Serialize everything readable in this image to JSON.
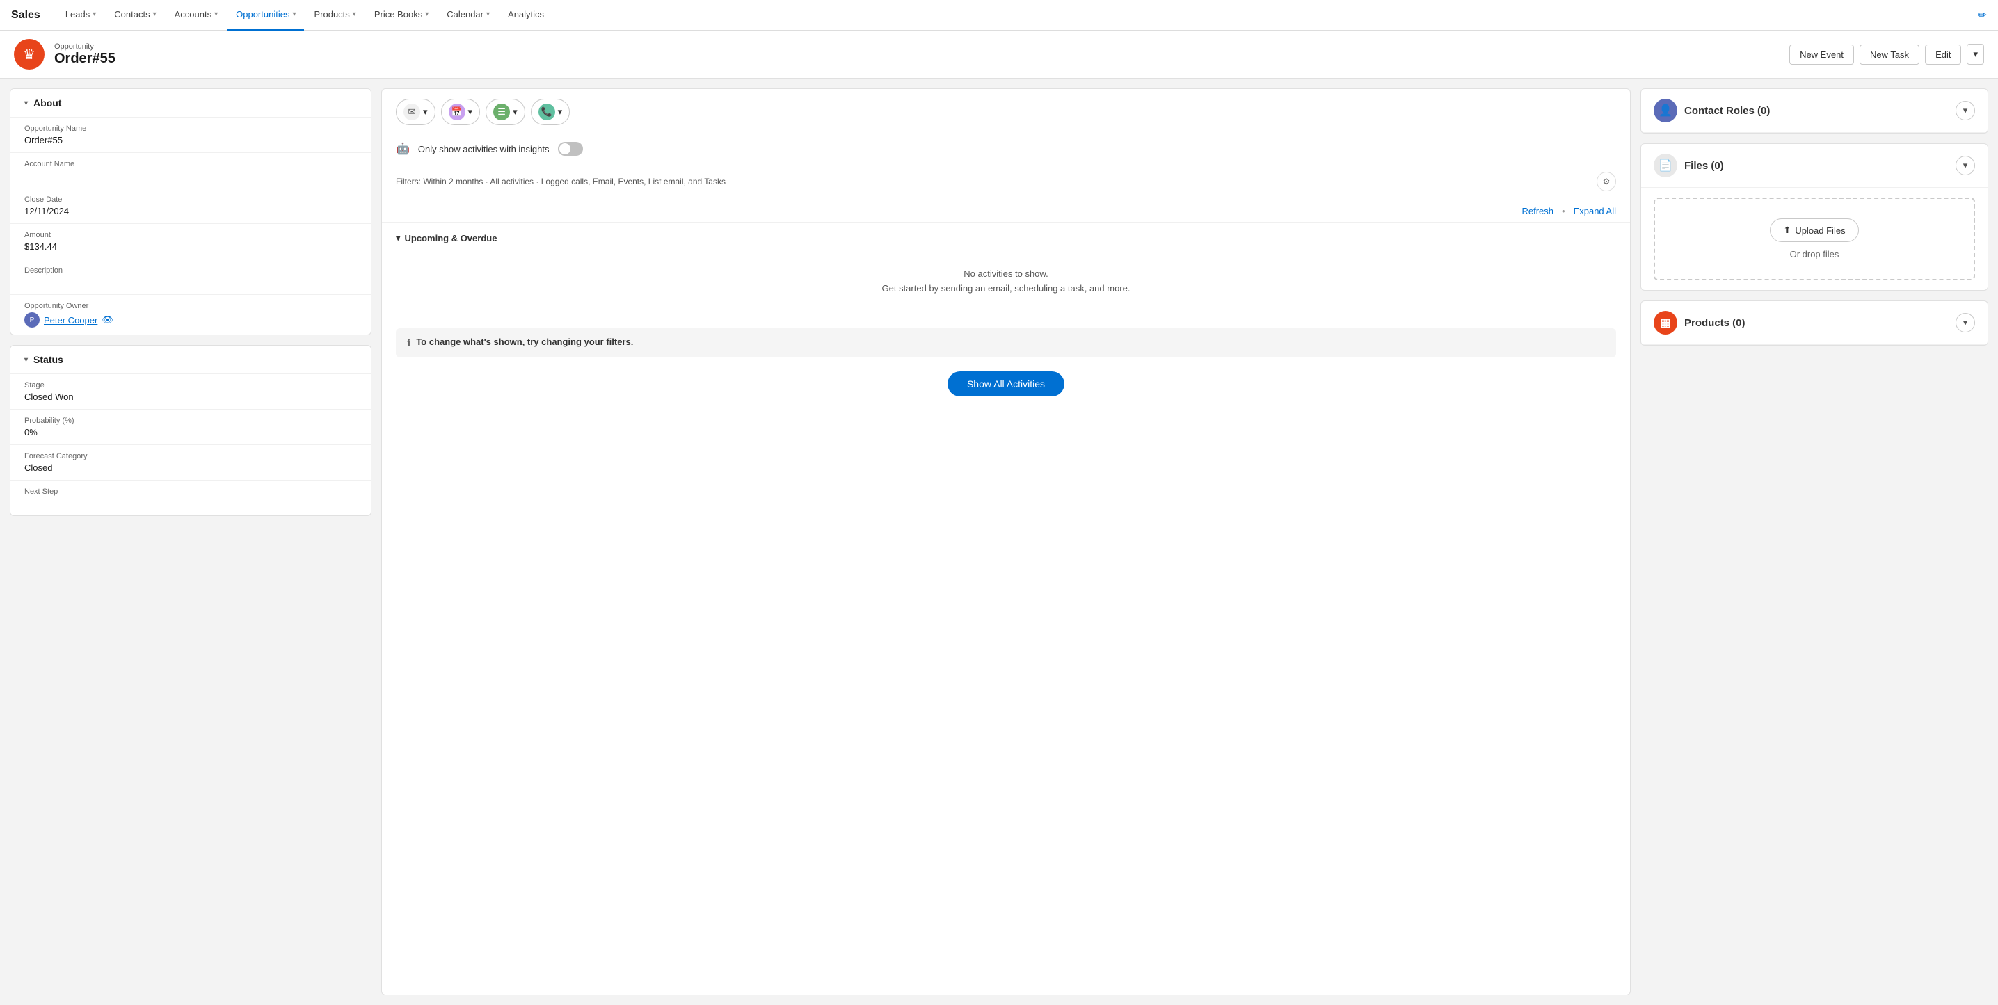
{
  "brand": "Sales",
  "nav": {
    "items": [
      {
        "label": "Leads",
        "hasDropdown": true,
        "active": false
      },
      {
        "label": "Contacts",
        "hasDropdown": true,
        "active": false
      },
      {
        "label": "Accounts",
        "hasDropdown": true,
        "active": false
      },
      {
        "label": "Opportunities",
        "hasDropdown": true,
        "active": true
      },
      {
        "label": "Products",
        "hasDropdown": true,
        "active": false
      },
      {
        "label": "Price Books",
        "hasDropdown": true,
        "active": false
      },
      {
        "label": "Calendar",
        "hasDropdown": true,
        "active": false
      },
      {
        "label": "Analytics",
        "hasDropdown": false,
        "active": false
      }
    ]
  },
  "page": {
    "breadcrumb": "Opportunity",
    "title": "Order#55",
    "actions": {
      "new_event": "New Event",
      "new_task": "New Task",
      "edit": "Edit"
    }
  },
  "about": {
    "section_title": "About",
    "fields": [
      {
        "label": "Opportunity Name",
        "value": "Order#55"
      },
      {
        "label": "Account Name",
        "value": ""
      },
      {
        "label": "Close Date",
        "value": "12/11/2024"
      },
      {
        "label": "Amount",
        "value": "$134.44"
      },
      {
        "label": "Description",
        "value": ""
      },
      {
        "label": "Opportunity Owner",
        "value": "Peter Cooper",
        "isOwner": true
      }
    ]
  },
  "status": {
    "section_title": "Status",
    "fields": [
      {
        "label": "Stage",
        "value": "Closed Won"
      },
      {
        "label": "Probability (%)",
        "value": "0%"
      },
      {
        "label": "Forecast Category",
        "value": "Closed"
      },
      {
        "label": "Next Step",
        "value": ""
      }
    ]
  },
  "activity": {
    "buttons": [
      {
        "icon": "✉",
        "iconClass": "email-icon",
        "label": ""
      },
      {
        "icon": "📅",
        "iconClass": "calendar-icon",
        "label": ""
      },
      {
        "icon": "☰",
        "iconClass": "list-icon",
        "label": ""
      },
      {
        "icon": "📞",
        "iconClass": "phone-icon",
        "label": ""
      }
    ],
    "insights_label": "Only show activities with insights",
    "filters_text": "Filters: Within 2 months · All activities · Logged calls, Email, Events, List email, and Tasks",
    "refresh": "Refresh",
    "expand_all": "Expand All",
    "upcoming_label": "Upcoming & Overdue",
    "no_activities_line1": "No activities to show.",
    "no_activities_line2": "Get started by sending an email, scheduling a task, and more.",
    "change_filters_text": "To change what's shown, try changing your filters.",
    "show_all_label": "Show All Activities"
  },
  "contact_roles": {
    "title": "Contact Roles (0)"
  },
  "files": {
    "title": "Files (0)",
    "upload_button": "Upload Files",
    "drop_text": "Or drop files"
  },
  "products": {
    "title": "Products (0)"
  }
}
